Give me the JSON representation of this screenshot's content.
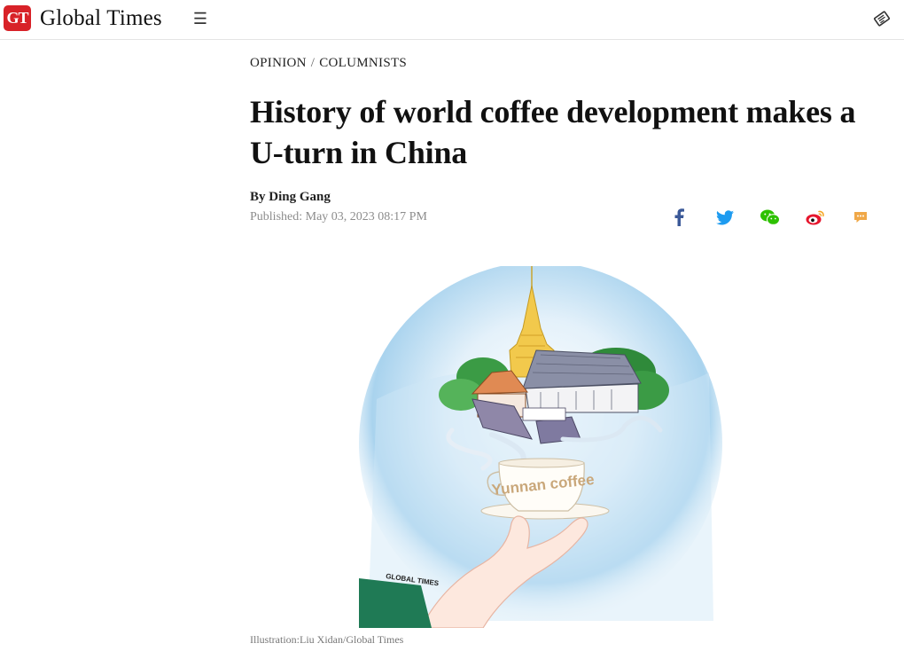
{
  "header": {
    "logo_mark": "GT",
    "brand_name": "Global Times",
    "menu_icon": "hamburger-menu-icon",
    "epaper_icon": "newspaper-icon"
  },
  "breadcrumb": {
    "section": "OPINION",
    "separator": "/",
    "subsection": "COLUMNISTS"
  },
  "article": {
    "headline": "History of world coffee development makes a U-turn in China",
    "byline": "By Ding Gang",
    "published": "Published: May 03, 2023 08:17 PM",
    "caption": "Illustration:Liu Xidan/Global Times"
  },
  "illustration": {
    "cup_text": "Yunnan coffee",
    "signature": "GLOBAL TIMES"
  },
  "share": [
    {
      "icon": "facebook-icon",
      "color": "#3b5998"
    },
    {
      "icon": "twitter-icon",
      "color": "#1d9bf0"
    },
    {
      "icon": "wechat-icon",
      "color": "#2dc100"
    },
    {
      "icon": "weibo-icon",
      "color": "#e6162d"
    },
    {
      "icon": "comment-icon",
      "color": "#f0a848"
    }
  ],
  "colors": {
    "brand_red": "#d82228",
    "meta_gray": "#8c8c8c"
  }
}
